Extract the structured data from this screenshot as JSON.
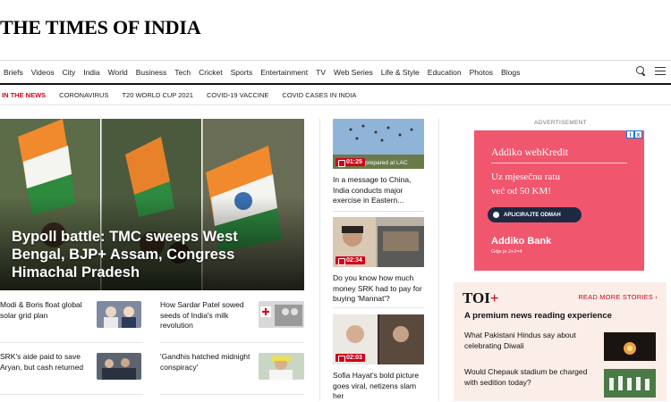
{
  "masthead": {
    "title": "THE TIMES OF INDIA"
  },
  "nav": {
    "items": [
      "Briefs",
      "Videos",
      "City",
      "India",
      "World",
      "Business",
      "Tech",
      "Cricket",
      "Sports",
      "Entertainment",
      "TV",
      "Web Series",
      "Life & Style",
      "Education",
      "Photos",
      "Blogs"
    ],
    "icons": [
      "search-icon",
      "menu-icon"
    ]
  },
  "trending": {
    "lead": "IN THE NEWS",
    "items": [
      "CORONAVIRUS",
      "T20 WORLD CUP 2021",
      "COVID-19 VACCINE",
      "COVID CASES IN INDIA"
    ]
  },
  "hero": {
    "title": "Bypoll battle: TMC sweeps West Bengal, BJP+ Assam, Congress Himachal Pradesh"
  },
  "sub_stories": [
    {
      "text": "Modi & Boris float global solar grid plan"
    },
    {
      "text": "How Sardar Patel sowed seeds of India's milk revolution"
    },
    {
      "text": "SRK's aide paid to save Aryan, but cash returned"
    },
    {
      "text": "'Gandhis hatched midnight conspiracy'"
    }
  ],
  "videos": [
    {
      "badge": "01:25",
      "caption_fragment": "prepared at LAC",
      "text": "In a message to China, India conducts major exercise in Eastern..."
    },
    {
      "badge": "02:34",
      "text": "Do you know how much money SRK had to pay for buying 'Mannat'?"
    },
    {
      "badge": "02:03",
      "text": "Sofia Hayat's bold picture goes viral, netizens slam her"
    }
  ],
  "ad": {
    "label": "ADVERTISEMENT",
    "brand": "Addiko webKredit",
    "copy_line1": "Uz mjesečnu ratu",
    "copy_line2": "već od 50 KM!",
    "button": "APLICIRAJTE ODMAH",
    "logo": "Addiko Bank",
    "logo_sub": "Gdje je 2+2=4",
    "info_icons": [
      "i",
      "x"
    ]
  },
  "toi_plus": {
    "logo_main": "TOI",
    "logo_plus": "+",
    "read_more": "READ MORE STORIES ›",
    "heading": "A premium news reading experience",
    "items": [
      {
        "text": "What Pakistani Hindus say about celebrating Diwali"
      },
      {
        "text": "Would Chepauk stadium be charged with sedition today?"
      }
    ]
  },
  "colors": {
    "brand_red": "#d0021b",
    "ad_pink": "#f0566e",
    "toi_bg": "#fbeee9"
  }
}
